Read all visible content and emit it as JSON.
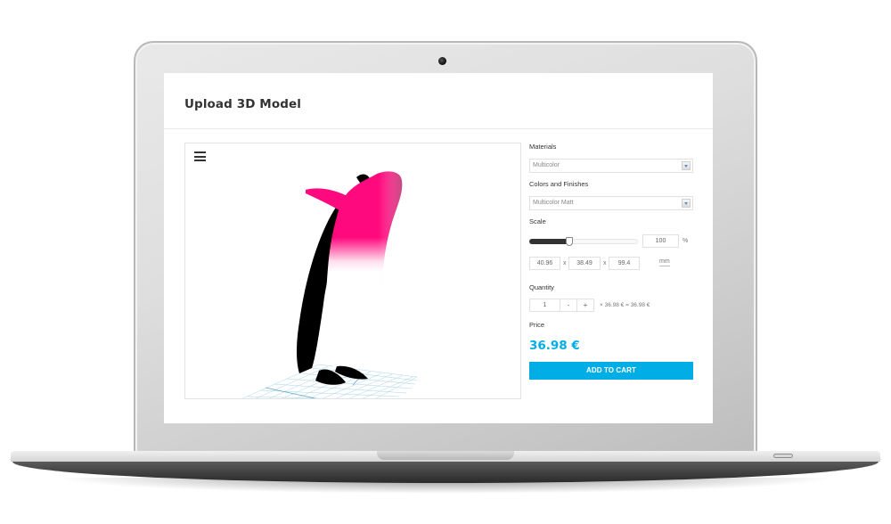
{
  "page": {
    "title": "Upload 3D Model"
  },
  "viewer": {
    "menu_icon": "hamburger-menu-icon",
    "model_colors": {
      "head": "#ff0a7e",
      "body_dark": "#000000",
      "body_light": "#ffffff",
      "grid": "#8ec3dc"
    }
  },
  "panel": {
    "materials": {
      "label": "Materials",
      "selected": "Multicolor"
    },
    "colors_finishes": {
      "label": "Colors and Finishes",
      "selected": "Multicolor Matt"
    },
    "scale": {
      "label": "Scale",
      "percent_value": "100",
      "percent_unit": "%",
      "slider_fraction": 0.37,
      "dim_x": "40.96",
      "dim_y": "38.49",
      "dim_z": "99.4",
      "separator": "x",
      "unit": "mm"
    },
    "quantity": {
      "label": "Quantity",
      "value": "1",
      "minus_label": "-",
      "plus_label": "+",
      "calculation": "× 36.98 € = 36.98 €"
    },
    "price": {
      "label": "Price",
      "value": "36.98 €"
    },
    "add_to_cart_label": "ADD TO CART"
  },
  "colors": {
    "accent": "#00aee5"
  }
}
